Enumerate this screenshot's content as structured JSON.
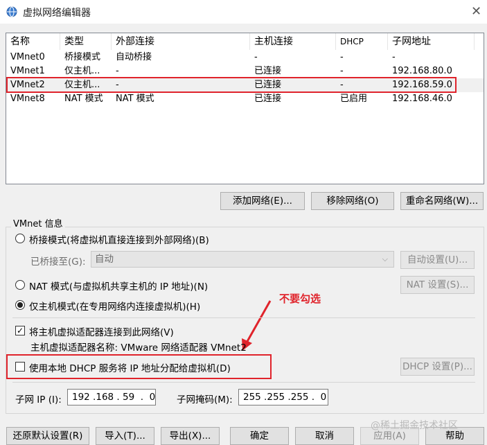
{
  "window": {
    "title": "虚拟网络编辑器",
    "close_symbol": "✕"
  },
  "table": {
    "columns": [
      "名称",
      "类型",
      "外部连接",
      "主机连接",
      "DHCP",
      "子网地址"
    ],
    "rows": [
      {
        "name": "VMnet0",
        "type": "桥接模式",
        "external": "自动桥接",
        "host": "-",
        "dhcp": "-",
        "subnet": "-"
      },
      {
        "name": "VMnet1",
        "type": "仅主机...",
        "external": "-",
        "host": "已连接",
        "dhcp": "-",
        "subnet": "192.168.80.0"
      },
      {
        "name": "VMnet2",
        "type": "仅主机...",
        "external": "-",
        "host": "已连接",
        "dhcp": "-",
        "subnet": "192.168.59.0"
      },
      {
        "name": "VMnet8",
        "type": "NAT 模式",
        "external": "NAT 模式",
        "host": "已连接",
        "dhcp": "已启用",
        "subnet": "192.168.46.0"
      }
    ],
    "selected_row": "VMnet2"
  },
  "table_buttons": {
    "add": "添加网络(E)...",
    "remove": "移除网络(O)",
    "rename": "重命名网络(W)..."
  },
  "vmnet_info": {
    "legend": "VMnet 信息",
    "bridge_mode_label": "桥接模式(将虚拟机直接连接到外部网络)(B)",
    "bridged_to_label": "已桥接至(G):",
    "bridged_to_value": "自动",
    "auto_settings_button": "自动设置(U)...",
    "nat_mode_label": "NAT 模式(与虚拟机共享主机的 IP 地址)(N)",
    "nat_settings_button": "NAT 设置(S)...",
    "host_only_label": "仅主机模式(在专用网络内连接虚拟机)(H)",
    "selected_mode": "host_only",
    "connect_adapter_label": "将主机虚拟适配器连接到此网络(V)",
    "connect_adapter_checked": true,
    "adapter_name_label": "主机虚拟适配器名称: VMware 网络适配器 VMnet2",
    "use_dhcp_label": "使用本地 DHCP 服务将 IP 地址分配给虚拟机(D)",
    "use_dhcp_checked": false,
    "dhcp_settings_button": "DHCP 设置(P)...",
    "subnet_ip_label": "子网 IP (I):",
    "subnet_ip_value": "192 .168 . 59  .  0",
    "subnet_mask_label": "子网掩码(M):",
    "subnet_mask_value": "255 .255 .255 .  0"
  },
  "annotation": {
    "text": "不要勾选",
    "color": "#e0232b"
  },
  "footer_buttons": {
    "restore_defaults": "还原默认设置(R)",
    "import": "导入(T)...",
    "export": "导出(X)...",
    "ok": "确定",
    "cancel": "取消",
    "apply": "应用(A)",
    "help": "帮助"
  },
  "watermark": "@稀土掘金技术社区",
  "colors": {
    "accent_red": "#e0232b",
    "window_bg": "#f0f0f0",
    "button_bg": "#e1e1e1"
  },
  "icons": {
    "app": "network-globe-icon",
    "check": "✓",
    "chevron": "⌵"
  }
}
